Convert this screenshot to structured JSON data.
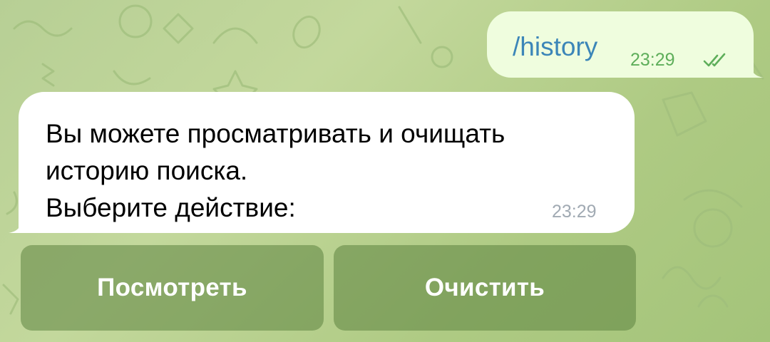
{
  "messages": {
    "outgoing": {
      "text": "/history",
      "time": "23:29",
      "status_icon": "double-check-read-icon"
    },
    "incoming": {
      "lines": [
        "Вы можете просматривать и очищать",
        "историю поиска.",
        "Выберите действие:"
      ],
      "time": "23:29"
    }
  },
  "keyboard": {
    "buttons": [
      {
        "label": "Посмотреть"
      },
      {
        "label": "Очистить"
      }
    ]
  },
  "colors": {
    "background": "#b7cf95",
    "outgoing_bubble": "#effdde",
    "incoming_bubble": "#ffffff",
    "command_link": "#3c86b8",
    "outgoing_meta": "#5eae5a",
    "incoming_meta": "#a1aab3",
    "keyboard_button": "#7d9e5f"
  }
}
